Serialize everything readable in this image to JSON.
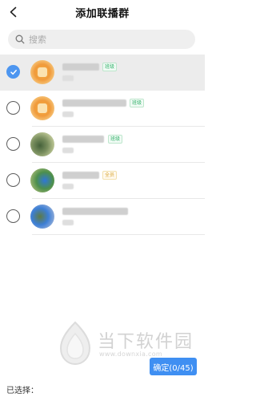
{
  "header": {
    "title": "添加联播群",
    "back_icon": "chevron-left-icon"
  },
  "search": {
    "placeholder": "搜索",
    "value": "",
    "icon": "search-icon"
  },
  "groups": [
    {
      "selected": true,
      "tag": "班级"
    },
    {
      "selected": false,
      "tag": "班级"
    },
    {
      "selected": false,
      "tag": "班级"
    },
    {
      "selected": false,
      "tag": "全员"
    },
    {
      "selected": false,
      "tag": ""
    }
  ],
  "footer": {
    "selected_label": "已选择：",
    "confirm_label": "确定(0/45)"
  },
  "watermark": {
    "brand": "当下软件园",
    "url": "www.downxia.com"
  },
  "colors": {
    "accent": "#3f8ff2",
    "checked": "#4d96f0",
    "tag_green": "#35b26c",
    "tag_yellow": "#d9a531"
  }
}
